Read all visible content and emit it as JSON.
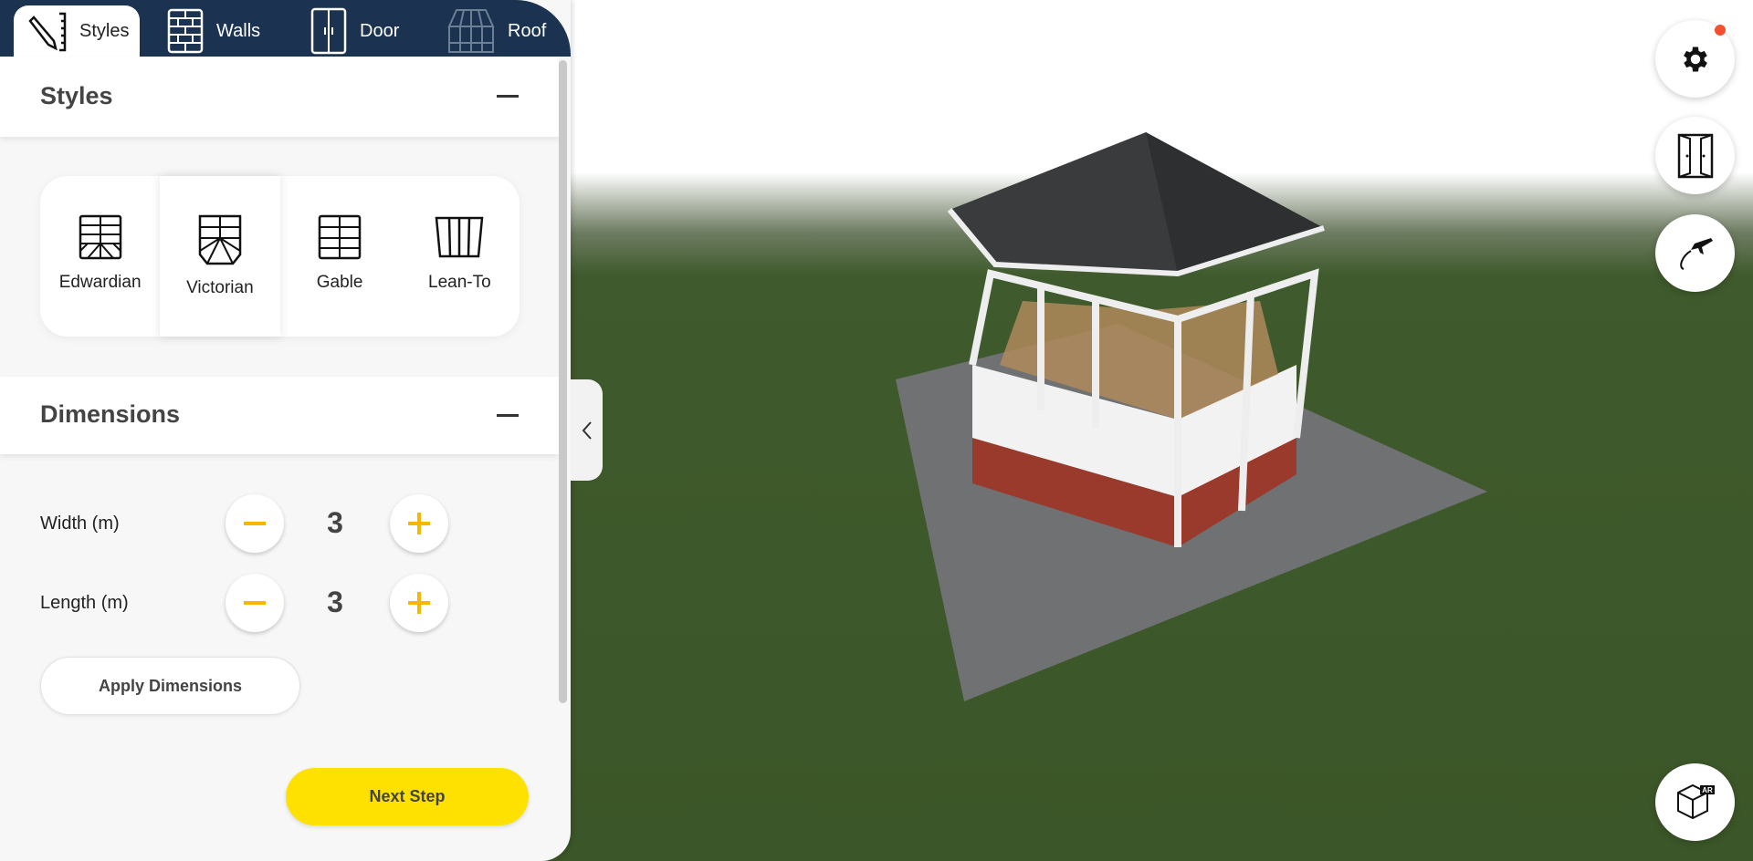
{
  "tabs": [
    {
      "label": "Styles",
      "icon": "pencil-ruler-icon",
      "active": true
    },
    {
      "label": "Walls",
      "icon": "brick-wall-icon"
    },
    {
      "label": "Door",
      "icon": "door-icon"
    },
    {
      "label": "Roof",
      "icon": "roof-icon"
    }
  ],
  "styles": {
    "title": "Styles",
    "options": [
      {
        "label": "Edwardian"
      },
      {
        "label": "Victorian",
        "selected": true
      },
      {
        "label": "Gable"
      },
      {
        "label": "Lean-To"
      }
    ]
  },
  "dimensions": {
    "title": "Dimensions",
    "width": {
      "label": "Width (m)",
      "value": "3"
    },
    "length": {
      "label": "Length (m)",
      "value": "3"
    },
    "apply_label": "Apply Dimensions"
  },
  "next_label": "Next Step",
  "toolbar": {
    "buttons": [
      "gear-icon",
      "double-door-icon",
      "fly-around-icon",
      "ar-cube-icon"
    ],
    "notification_dot": true
  },
  "colors": {
    "navy": "#1b3350",
    "accent_yellow": "#ffe100",
    "stepper_icon": "#f5b800",
    "notification": "#f4502f"
  }
}
